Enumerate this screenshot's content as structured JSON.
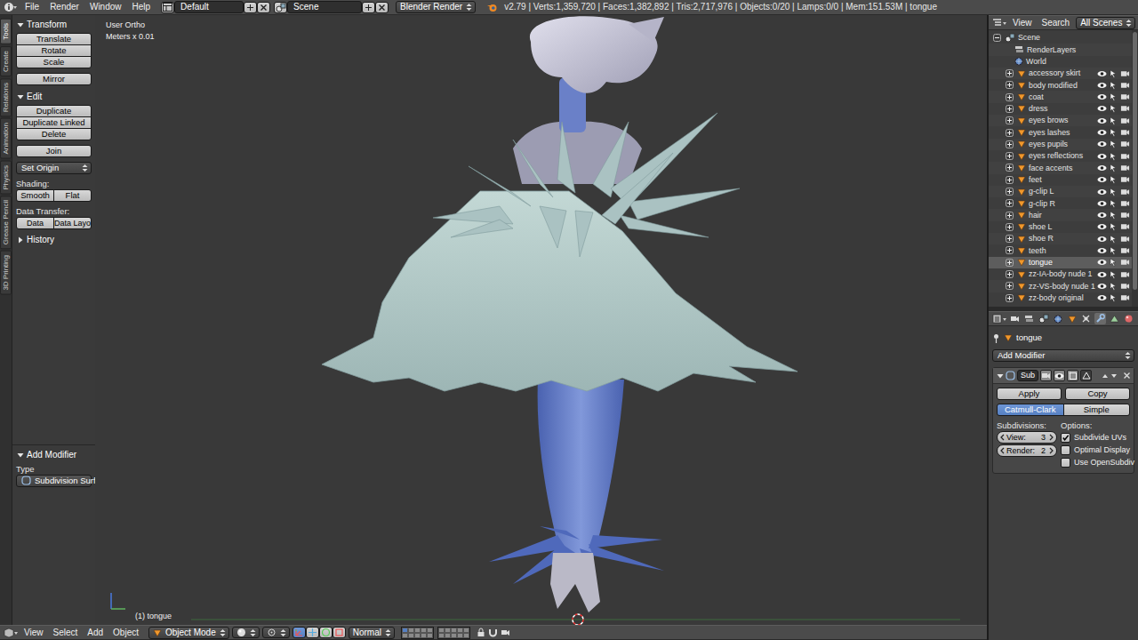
{
  "topbar": {
    "menus": [
      "File",
      "Render",
      "Window",
      "Help"
    ],
    "layout": "Default",
    "scene": "Scene",
    "engine": "Blender Render",
    "stats": "v2.79 | Verts:1,359,720 | Faces:1,382,892 | Tris:2,717,976 | Objects:0/20 | Lamps:0/0 | Mem:151.53M | tongue"
  },
  "toolshelf": {
    "tabs": [
      {
        "label": "Tools",
        "selected": true
      },
      {
        "label": "Create",
        "selected": false
      },
      {
        "label": "Relations",
        "selected": false
      },
      {
        "label": "Animation",
        "selected": false
      },
      {
        "label": "Physics",
        "selected": false
      },
      {
        "label": "Grease Pencil",
        "selected": false
      },
      {
        "label": "3D Printing",
        "selected": false
      }
    ],
    "transform": {
      "title": "Transform",
      "expanded": true,
      "buttons": [
        "Translate",
        "Rotate",
        "Scale"
      ],
      "mirror": "Mirror"
    },
    "edit": {
      "title": "Edit",
      "expanded": true,
      "buttons": [
        "Duplicate",
        "Duplicate Linked",
        "Delete"
      ],
      "join": "Join",
      "set_origin": "Set Origin",
      "shading_label": "Shading:",
      "shading": [
        "Smooth",
        "Flat"
      ],
      "data_transfer_label": "Data Transfer:",
      "data_transfer": [
        "Data",
        "Data Layo"
      ]
    },
    "history": {
      "title": "History",
      "expanded": false
    }
  },
  "operator": {
    "title": "Add Modifier",
    "expanded": true,
    "type_label": "Type",
    "type_value": "Subdivision Surface"
  },
  "viewport": {
    "view_name": "User Ortho",
    "units": "Meters x 0.01",
    "object_info": "(1) tongue"
  },
  "bottom_header": {
    "menus": [
      "View",
      "Select",
      "Add",
      "Object"
    ],
    "mode": "Object Mode",
    "orientation": "Normal",
    "layers": [
      true,
      false,
      false,
      false,
      false,
      false,
      false,
      false,
      false,
      false,
      false,
      false,
      false,
      false,
      false,
      false,
      false,
      false,
      false,
      false
    ]
  },
  "outliner": {
    "menus": [
      "View",
      "Search"
    ],
    "filter": "All Scenes",
    "items": [
      {
        "label": "Scene",
        "kind": "scene",
        "expanded": true,
        "selected": false
      },
      {
        "label": "RenderLayers",
        "kind": "layers",
        "selected": false
      },
      {
        "label": "World",
        "kind": "world",
        "selected": false
      },
      {
        "label": "accessory skirt",
        "kind": "object",
        "expanded": false,
        "selected": false,
        "visible": true
      },
      {
        "label": "body modified",
        "kind": "object",
        "expanded": false,
        "selected": false,
        "visible": true
      },
      {
        "label": "coat",
        "kind": "object",
        "expanded": false,
        "selected": false,
        "visible": true
      },
      {
        "label": "dress",
        "kind": "object",
        "expanded": false,
        "selected": false,
        "visible": true
      },
      {
        "label": "eyes brows",
        "kind": "object",
        "expanded": false,
        "selected": false,
        "visible": true
      },
      {
        "label": "eyes lashes",
        "kind": "object",
        "expanded": false,
        "selected": false,
        "visible": true
      },
      {
        "label": "eyes pupils",
        "kind": "object",
        "expanded": false,
        "selected": false,
        "visible": true
      },
      {
        "label": "eyes reflections",
        "kind": "object",
        "expanded": false,
        "selected": false,
        "visible": true
      },
      {
        "label": "face accents",
        "kind": "object",
        "expanded": false,
        "selected": false,
        "visible": true
      },
      {
        "label": "feet",
        "kind": "object",
        "expanded": false,
        "selected": false,
        "visible": true
      },
      {
        "label": "g-clip L",
        "kind": "object",
        "expanded": false,
        "selected": false,
        "visible": true
      },
      {
        "label": "g-clip R",
        "kind": "object",
        "expanded": false,
        "selected": false,
        "visible": true
      },
      {
        "label": "hair",
        "kind": "object",
        "expanded": false,
        "selected": false,
        "visible": true
      },
      {
        "label": "shoe L",
        "kind": "object",
        "expanded": false,
        "selected": false,
        "visible": true
      },
      {
        "label": "shoe R",
        "kind": "object",
        "expanded": false,
        "selected": false,
        "visible": true
      },
      {
        "label": "teeth",
        "kind": "object",
        "expanded": false,
        "selected": false,
        "visible": true
      },
      {
        "label": "tongue",
        "kind": "object",
        "expanded": false,
        "selected": true,
        "visible": true
      },
      {
        "label": "zz-IA-body nude 1",
        "kind": "object",
        "expanded": false,
        "selected": false,
        "visible": true
      },
      {
        "label": "zz-VS-body nude 1",
        "kind": "object",
        "expanded": false,
        "selected": false,
        "visible": true
      },
      {
        "label": "zz-body original",
        "kind": "object",
        "expanded": false,
        "selected": false,
        "visible": true
      }
    ]
  },
  "properties": {
    "tabs": [
      {
        "selected": false
      },
      {
        "selected": false
      },
      {
        "selected": false
      },
      {
        "selected": false
      },
      {
        "selected": false
      },
      {
        "selected": false
      },
      {
        "selected": true
      },
      {
        "selected": false
      },
      {
        "selected": false
      },
      {
        "selected": false
      }
    ],
    "context": "tongue",
    "add_modifier": "Add Modifier",
    "modifier": {
      "name": "Sub",
      "expanded": true,
      "toggles": [
        {
          "on": true
        },
        {
          "on": true
        },
        {
          "on": true
        },
        {
          "on": false
        }
      ],
      "apply": "Apply",
      "copy": "Copy",
      "types": [
        {
          "label": "Catmull-Clark",
          "selected": true
        },
        {
          "label": "Simple",
          "selected": false
        }
      ],
      "subdivisions_label": "Subdivisions:",
      "levels": [
        {
          "label": "View:",
          "value": "3"
        },
        {
          "label": "Render:",
          "value": "2"
        }
      ],
      "options_label": "Options:",
      "options": [
        {
          "label": "Subdivide UVs",
          "checked": true
        },
        {
          "label": "Optimal Display",
          "checked": false
        },
        {
          "label": "Use OpenSubdiv",
          "checked": false
        }
      ]
    }
  }
}
